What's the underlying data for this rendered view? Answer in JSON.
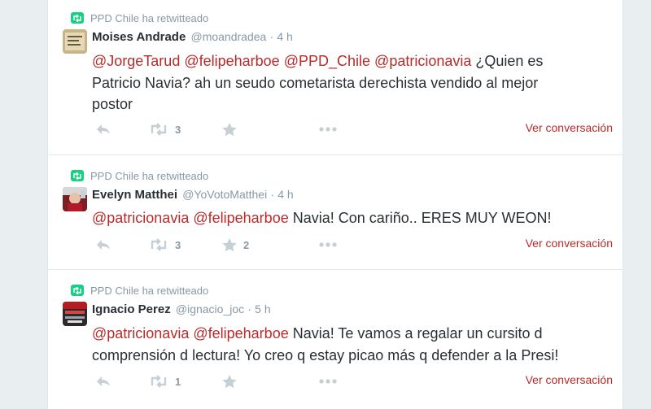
{
  "tweets": [
    {
      "retweeter": "PPD Chile ha retwitteado",
      "fullname": "Moises Andrade",
      "username": "@moandradea",
      "time": "4 h",
      "lines": [
        [
          {
            "t": "@JorgeTarud",
            "m": true
          },
          {
            "t": " "
          },
          {
            "t": "@felipeharboe",
            "m": true
          },
          {
            "t": " "
          },
          {
            "t": "@PPD_Chile",
            "m": true
          },
          {
            "t": " "
          },
          {
            "t": "@patricionavia",
            "m": true
          },
          {
            "t": " ¿Quien es"
          }
        ],
        [
          {
            "t": "Patricio Navia? ah un seudo cometarista derechista vendido al mejor"
          }
        ],
        [
          {
            "t": "postor"
          }
        ]
      ],
      "retweets": "3",
      "favorites": "",
      "convo": "Ver conversación"
    },
    {
      "retweeter": "PPD Chile ha retwitteado",
      "fullname": "Evelyn Matthei",
      "username": "@YoVotoMatthei",
      "time": "4 h",
      "lines": [
        [
          {
            "t": "@patricionavia",
            "m": true
          },
          {
            "t": " "
          },
          {
            "t": "@felipeharboe",
            "m": true
          },
          {
            "t": " Navia! Con cariño.. ERES MUY WEON!"
          }
        ]
      ],
      "retweets": "3",
      "favorites": "2",
      "convo": "Ver conversación"
    },
    {
      "retweeter": "PPD Chile ha retwitteado",
      "fullname": "Ignacio Perez",
      "username": "@ignacio_joc",
      "time": "5 h",
      "lines": [
        [
          {
            "t": "@patricionavia",
            "m": true
          },
          {
            "t": " "
          },
          {
            "t": "@felipeharboe",
            "m": true
          },
          {
            "t": " Navia! Te vamos a regalar un cursito d"
          }
        ],
        [
          {
            "t": "comprensión d lectura! Yo creo q estay picao más q defender a la Presi!"
          }
        ]
      ],
      "retweets": "1",
      "favorites": "",
      "convo": "Ver conversación"
    }
  ],
  "colors": {
    "mention": "#b82b2b",
    "retweet_green": "#19cf86",
    "muted": "#8899a6"
  }
}
